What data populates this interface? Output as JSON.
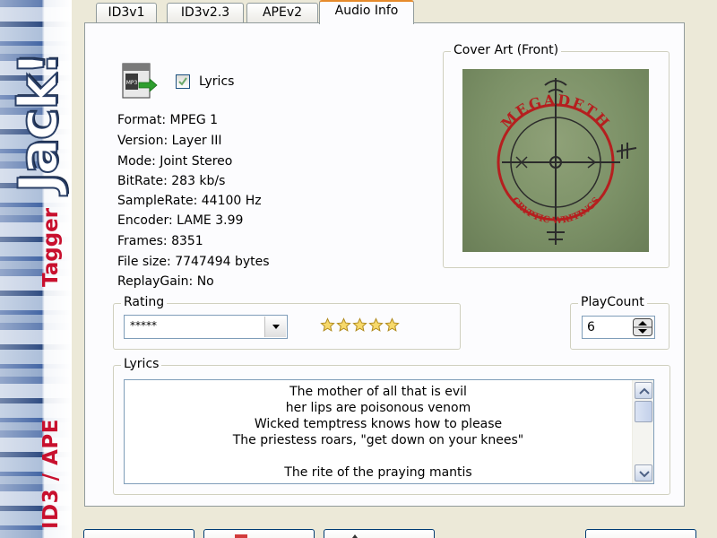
{
  "branding": {
    "logo": "Jack!",
    "subtitle_a": "ID3 / APE",
    "subtitle_b": "Tagger"
  },
  "tabs": [
    {
      "label": "ID3v1",
      "active": false
    },
    {
      "label": "ID3v2.3",
      "active": false
    },
    {
      "label": "APEv2",
      "active": false
    },
    {
      "label": "Audio Info",
      "active": true
    }
  ],
  "audio_info": {
    "lyrics_checkbox": {
      "label": "Lyrics",
      "checked": true
    },
    "lines": [
      "Format: MPEG 1",
      "Version: Layer III",
      "Mode: Joint Stereo",
      "BitRate: 283 kb/s",
      "SampleRate: 44100 Hz",
      "Encoder: LAME 3.99",
      "Frames: 8351",
      "File size: 7747494 bytes",
      "ReplayGain: No"
    ],
    "icon_label": "MP3"
  },
  "cover_art": {
    "title": "Cover Art (Front)",
    "band_text": "MEGADETH",
    "album_text": "CRYPTIC WRITINGS"
  },
  "rating": {
    "title": "Rating",
    "selected": "*****",
    "stars": 5
  },
  "playcount": {
    "title": "PlayCount",
    "value": "6"
  },
  "lyrics": {
    "title": "Lyrics",
    "lines": [
      "The mother of all that is evil",
      "her lips are poisonous venom",
      "Wicked temptress knows how to please",
      "The priestess roars, \"get down on your knees\"",
      "",
      "The rite of the praying mantis"
    ]
  },
  "colors": {
    "accent_tab": "#e68b2c",
    "brand_red": "#c8102e",
    "cover_red": "#b51f1f",
    "cover_bg": "#7c9167"
  }
}
